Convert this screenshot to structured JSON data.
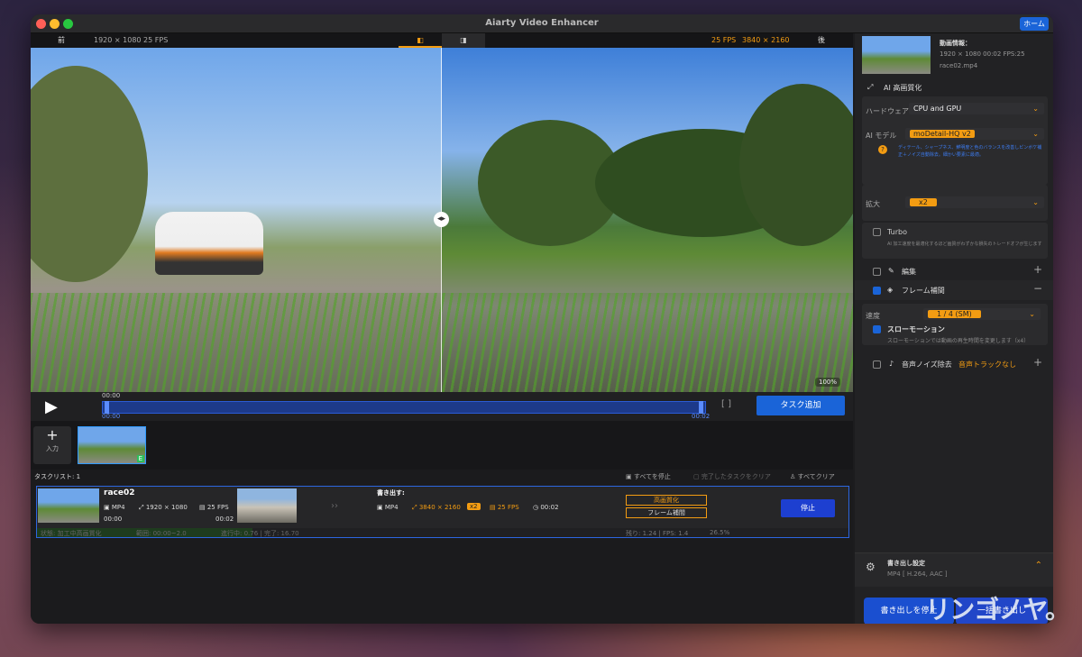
{
  "window": {
    "title": "Aiarty Video Enhancer",
    "home_label": "ホーム"
  },
  "compare": {
    "before_label": "前",
    "before_info": "1920 × 1080   25 FPS",
    "after_fps": "25 FPS",
    "after_res": "3840 × 2160",
    "after_label": "後"
  },
  "preview": {
    "zoom": "100%"
  },
  "timeline": {
    "time_top": "00:00",
    "time_start": "00:00",
    "time_end": "00:02",
    "add_task_label": "タスク追加"
  },
  "thumbs": {
    "input_label": "入力",
    "badge": "E"
  },
  "tasklist": {
    "title": "タスクリスト: 1",
    "stop_all": "すべてを停止",
    "clear_done": "完了したタスクをクリア",
    "clear_all": "すべてクリア",
    "task": {
      "name": "race02",
      "format": "MP4",
      "resolution": "1920 × 1080",
      "fps": "25 FPS",
      "start": "00:00",
      "end": "00:02",
      "export_label": "書き出す:",
      "out_format": "MP4",
      "out_res": "3840 × 2160",
      "scale": "x2",
      "out_fps": "25 FPS",
      "out_duration": "00:02",
      "tag1": "高画質化",
      "tag2": "フレーム補間",
      "stop_label": "停止",
      "status": "状態: 加工中高画質化",
      "range": "範囲: 00:00~2.0",
      "progress_text": "進行中: 0.76 | 完了: 16.70",
      "remaining": "残り: 1.24 | FPS: 1.4",
      "percent": "26.5%",
      "progress": 0.265
    }
  },
  "sidebar": {
    "video_info_title": "動画情報：",
    "video_info_meta": "1920 × 1080 00:02 FPS:25",
    "file_name": "race02.mp4",
    "ai_section": "AI 高画質化",
    "hardware_label": "ハードウェア",
    "hardware_value": "CPU and GPU",
    "model_label": "AI モデル",
    "model_value": "moDetail-HQ  v2",
    "model_desc": "ディテール、シャープネス、鮮明度と色のバランスを改善しピンボケ補正＋ノイズ自動除去。細かい要素に最適。",
    "upscale_label": "拡大",
    "upscale_value": "x2",
    "turbo_label": "Turbo",
    "turbo_desc": "AI 加工速度を最適化するほど画質がわずかな損失のトレードオフが生じます",
    "edit_label": "編集",
    "frame_interp_label": "フレーム補間",
    "speed_label": "速度",
    "speed_value": "1 / 4 (SM)",
    "slowmo_label": "スローモーション",
    "slowmo_desc": "スローモーションでは動画の再生時間を変更します（x4）",
    "audio_label": "音声ノイズ除去",
    "audio_status": "音声トラックなし",
    "export_settings_title": "書き出し設定",
    "export_settings_value": "MP4 [ H.264, AAC ]",
    "export_stop_label": "書き出しを停止",
    "export_all_label": "一括書き出し"
  },
  "watermark": "リンゴノヤ。",
  "colors": {
    "accent": "#1a64d8",
    "orange": "#f39c12"
  }
}
